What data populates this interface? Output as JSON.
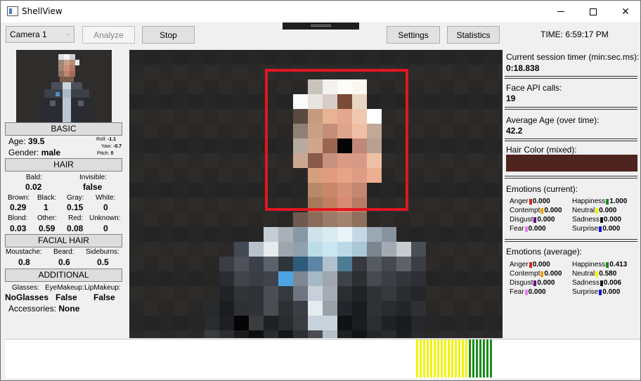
{
  "window": {
    "title": "ShellView"
  },
  "toolbar": {
    "camera": "Camera 1",
    "analyze": "Analyze",
    "stop": "Stop",
    "settings": "Settings",
    "statistics": "Statistics",
    "time": "TIME: 6:59:17 PM"
  },
  "basic": {
    "header": "BASIC",
    "age_label": "Age:",
    "age": "39.5",
    "gender_label": "Gender:",
    "gender": "male",
    "roll_label": "Roll:",
    "roll": "-1.1",
    "yaw_label": "Yaw:",
    "yaw": "-0.7",
    "pitch_label": "Pitch:",
    "pitch": "0"
  },
  "hair": {
    "header": "HAIR",
    "bald_label": "Bald:",
    "bald": "0.02",
    "invisible_label": "Invisible:",
    "invisible": "false",
    "brown_label": "Brown:",
    "brown": "0.29",
    "black_label": "Black:",
    "black": "1",
    "gray_label": "Gray:",
    "gray": "0.15",
    "white_label": "White:",
    "white": "0",
    "blond_label": "Blond:",
    "blond": "0.03",
    "other_label": "Other:",
    "other": "0.59",
    "red_label": "Red:",
    "red": "0.08",
    "unknown_label": "Unknown:",
    "unknown": "0"
  },
  "facial_hair": {
    "header": "FACIAL HAIR",
    "moustache_label": "Moustache:",
    "moustache": "0.8",
    "beard_label": "Beard:",
    "beard": "0.6",
    "sideburns_label": "Sideburns:",
    "sideburns": "0.5"
  },
  "additional": {
    "header": "ADDITIONAL",
    "glasses_label": "Glasses:",
    "glasses": "NoGlasses",
    "eyemakeup_label": "EyeMakeup:",
    "eyemakeup": "False",
    "lipmakeup_label": "LipMakeup:",
    "lipmakeup": "False",
    "accessories_label": "Accessories:",
    "accessories": "None"
  },
  "stats": {
    "session_label": "Current session timer (min:sec.ms):",
    "session": "0:18.838",
    "calls_label": "Face API calls:",
    "calls": "19",
    "avg_age_label": "Average Age (over time):",
    "avg_age": "42.2",
    "hair_color_label": "Hair Color (mixed):",
    "hair_color": "#4f2420"
  },
  "emotions_current": {
    "title": "Emotions (current):",
    "items": [
      {
        "label": "Anger",
        "value": "0.000",
        "color": "#e0201c"
      },
      {
        "label": "Happiness",
        "value": "1.000",
        "color": "#1a8c1a"
      },
      {
        "label": "Contempt",
        "value": "0.000",
        "color": "#f5a000"
      },
      {
        "label": "Neutral",
        "value": "0.000",
        "color": "#f2f200"
      },
      {
        "label": "Disgust",
        "value": "0.000",
        "color": "#6a0f8e"
      },
      {
        "label": "Sadness",
        "value": "0.000",
        "color": "#111111"
      },
      {
        "label": "Fear",
        "value": "0.000",
        "color": "#e47fe4"
      },
      {
        "label": "Surprise",
        "value": "0.000",
        "color": "#1010e0"
      }
    ]
  },
  "emotions_average": {
    "title": "Emotions (average):",
    "items": [
      {
        "label": "Anger",
        "value": "0.000",
        "color": "#e0201c"
      },
      {
        "label": "Happiness",
        "value": "0.413",
        "color": "#1a8c1a"
      },
      {
        "label": "Contempt",
        "value": "0.000",
        "color": "#f5a000"
      },
      {
        "label": "Neutral",
        "value": "0.580",
        "color": "#f2f200"
      },
      {
        "label": "Disgust",
        "value": "0.000",
        "color": "#6a0f8e"
      },
      {
        "label": "Sadness",
        "value": "0.006",
        "color": "#111111"
      },
      {
        "label": "Fear",
        "value": "0.000",
        "color": "#e47fe4"
      },
      {
        "label": "Surprise",
        "value": "0.000",
        "color": "#1010e0"
      }
    ]
  },
  "emotion_bars": [
    "#f2f200",
    "#f2f200",
    "#f2f200",
    "#f2f200",
    "#f2f200",
    "#f2f200",
    "#f2f200",
    "#f2f200",
    "#f2f200",
    "#f2f200",
    "#f2f200",
    "#f2f200",
    "#f2f200",
    "#f2f200",
    "#f2f200",
    "#1a8c1a",
    "#1a8c1a",
    "#1a8c1a",
    "#1a8c1a",
    "#1a8c1a",
    "#1a8c1a",
    "#1a8c1a"
  ]
}
